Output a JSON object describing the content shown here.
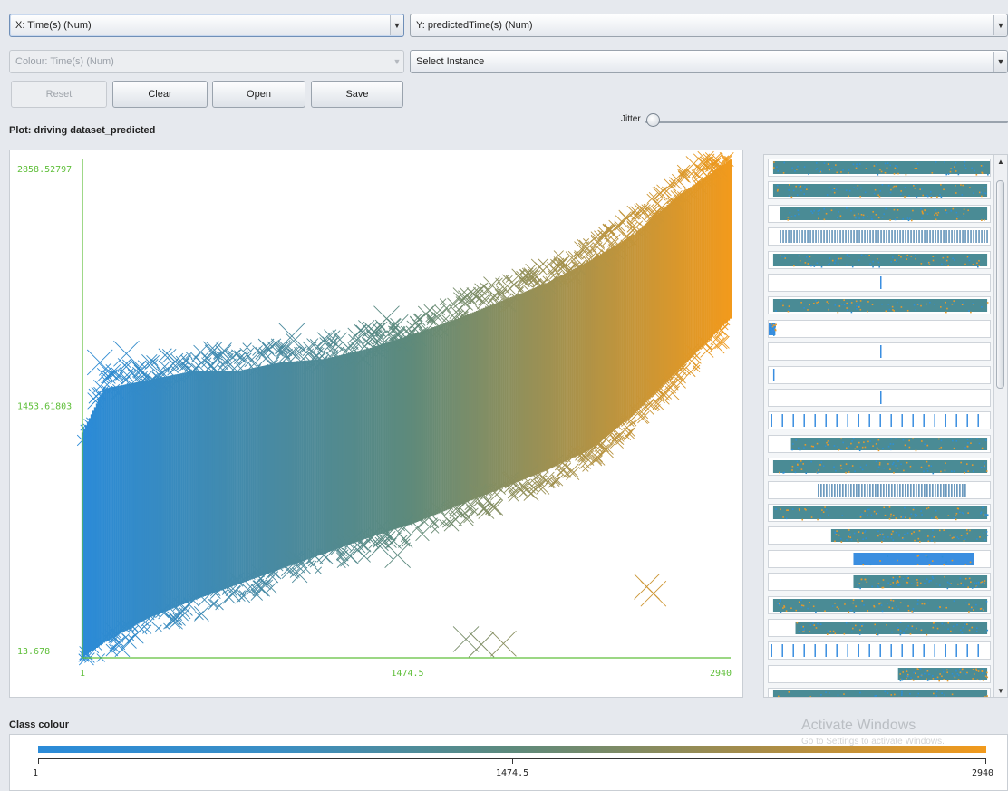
{
  "controls": {
    "x_axis_select": "X: Time(s) (Num)",
    "y_axis_select": "Y: predictedTime(s) (Num)",
    "colour_select": "Colour: Time(s) (Num)",
    "instance_select": "Select Instance",
    "reset_label": "Reset",
    "clear_label": "Clear",
    "open_label": "Open",
    "save_label": "Save",
    "jitter_label": "Jitter",
    "jitter_value": 0
  },
  "plot": {
    "title": "Plot: driving dataset_predicted"
  },
  "chart_data": {
    "type": "scatter",
    "xlabel": "",
    "ylabel": "",
    "xlim": [
      1,
      2940
    ],
    "ylim": [
      13.678,
      2858.52797
    ],
    "x_tick_labels": [
      "1",
      "1474.5",
      "2940"
    ],
    "y_tick_labels": [
      "13.678",
      "1453.61803",
      "2858.52797"
    ],
    "colour_by": "Time(s)",
    "colour_range": [
      1,
      2940
    ],
    "colours": {
      "low": "#2b8bd8",
      "mid": "#5d8a7c",
      "high": "#f29a1c"
    },
    "axis_colour": "#5fbf3a",
    "band": {
      "x": [
        1,
        100,
        300,
        500,
        700,
        900,
        1100,
        1300,
        1500,
        1700,
        1900,
        2100,
        2300,
        2500,
        2700,
        2940
      ],
      "y_low": [
        14,
        100,
        240,
        340,
        430,
        520,
        610,
        700,
        780,
        880,
        980,
        1080,
        1200,
        1400,
        1650,
        1950
      ],
      "y_high": [
        1300,
        1550,
        1600,
        1650,
        1650,
        1700,
        1720,
        1780,
        1860,
        1950,
        2050,
        2150,
        2280,
        2430,
        2650,
        2858
      ]
    },
    "outliers": [
      {
        "x": 1740,
        "y": 120
      },
      {
        "x": 1810,
        "y": 90
      },
      {
        "x": 1910,
        "y": 95
      },
      {
        "x": 1380,
        "y": 1950
      },
      {
        "x": 1420,
        "y": 1900
      },
      {
        "x": 2560,
        "y": 420
      },
      {
        "x": 2590,
        "y": 380
      },
      {
        "x": 1350,
        "y": 650
      },
      {
        "x": 1430,
        "y": 600
      },
      {
        "x": 80,
        "y": 1700
      },
      {
        "x": 200,
        "y": 1750
      },
      {
        "x": 950,
        "y": 1850
      }
    ]
  },
  "matrix": {
    "rows": [
      {
        "kind": "dense",
        "start": 0.02,
        "end": 1.0
      },
      {
        "kind": "dense",
        "start": 0.02,
        "end": 0.98
      },
      {
        "kind": "dense",
        "start": 0.05,
        "end": 0.98
      },
      {
        "kind": "striped",
        "start": 0.05,
        "end": 0.98
      },
      {
        "kind": "dense",
        "start": 0.02,
        "end": 0.98
      },
      {
        "kind": "line",
        "pos": 0.5
      },
      {
        "kind": "dense",
        "start": 0.02,
        "end": 0.98
      },
      {
        "kind": "block",
        "start": 0.0,
        "end": 0.03
      },
      {
        "kind": "line",
        "pos": 0.5
      },
      {
        "kind": "line",
        "pos": 0.02
      },
      {
        "kind": "line",
        "pos": 0.5
      },
      {
        "kind": "ticks",
        "start": 0.01,
        "end": 0.97
      },
      {
        "kind": "dense",
        "start": 0.1,
        "end": 0.98
      },
      {
        "kind": "dense",
        "start": 0.02,
        "end": 0.98
      },
      {
        "kind": "striped",
        "start": 0.22,
        "end": 0.88
      },
      {
        "kind": "dense",
        "start": 0.02,
        "end": 0.98
      },
      {
        "kind": "dense",
        "start": 0.28,
        "end": 0.98
      },
      {
        "kind": "block",
        "start": 0.38,
        "end": 0.92
      },
      {
        "kind": "dense",
        "start": 0.38,
        "end": 0.98
      },
      {
        "kind": "dense",
        "start": 0.02,
        "end": 0.98
      },
      {
        "kind": "dense",
        "start": 0.12,
        "end": 0.98
      },
      {
        "kind": "ticks",
        "start": 0.01,
        "end": 0.97
      },
      {
        "kind": "dense",
        "start": 0.58,
        "end": 0.98
      },
      {
        "kind": "dense",
        "start": 0.02,
        "end": 0.98
      }
    ]
  },
  "class_colour": {
    "title": "Class colour",
    "min_label": "1",
    "mid_label": "1474.5",
    "max_label": "2940"
  },
  "watermark": {
    "title": "Activate Windows",
    "subtitle": "Go to Settings to activate Windows."
  }
}
